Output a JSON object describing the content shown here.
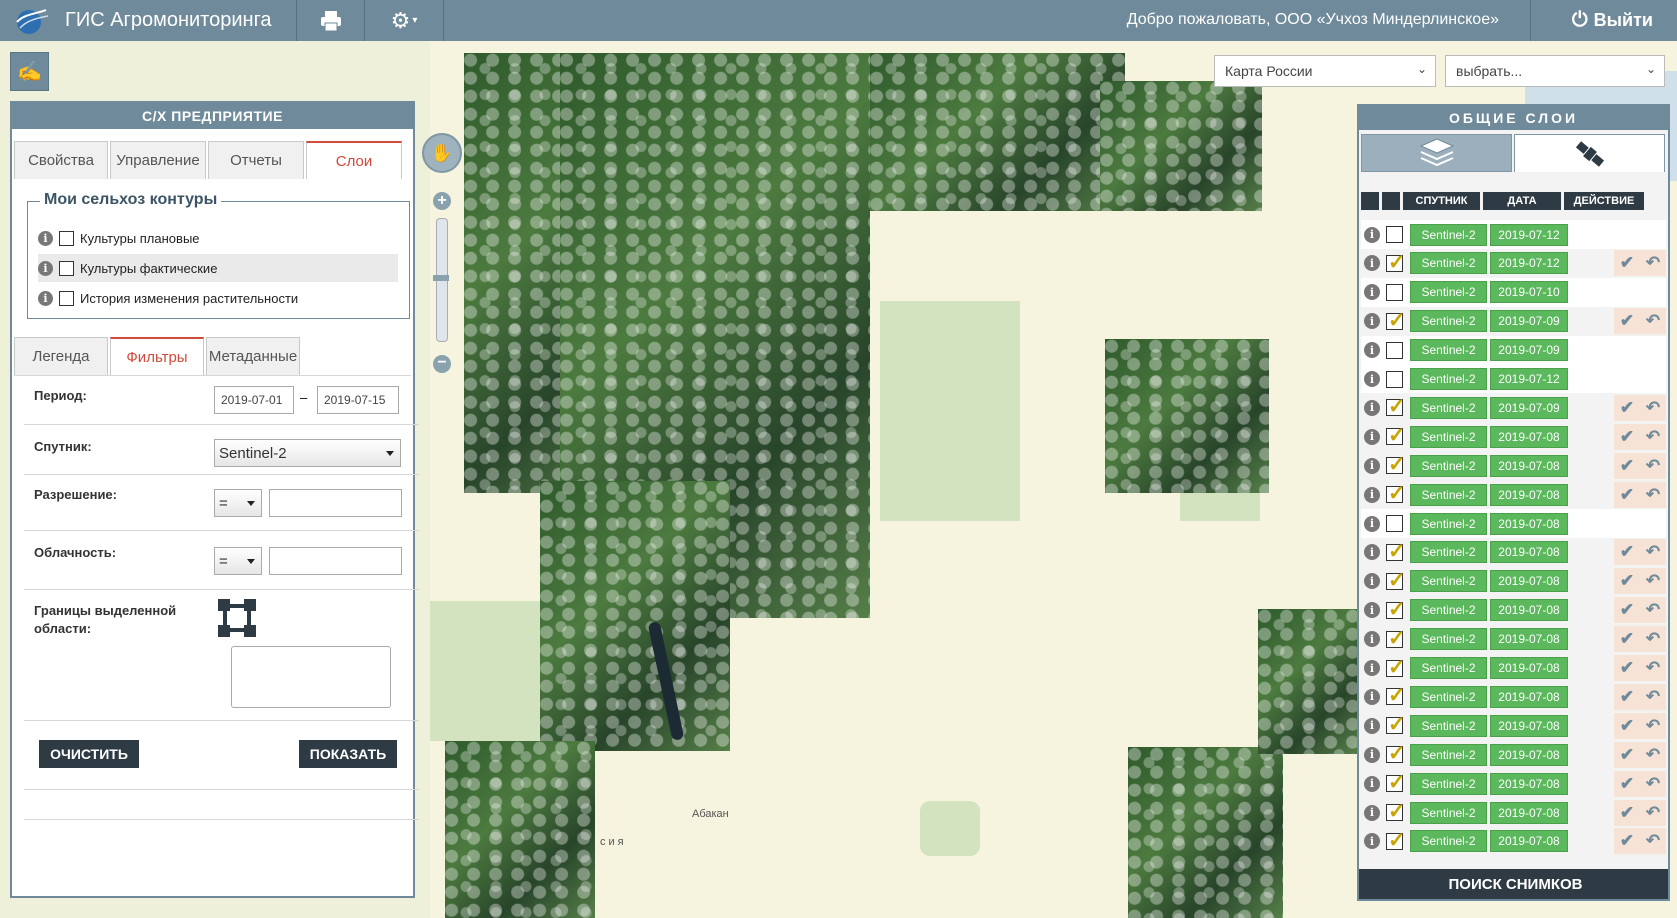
{
  "topbar": {
    "title": "ГИС Агромониторинга",
    "welcome": "Добро пожаловать, ООО «Учхоз Миндерлинское»",
    "logout": "Выйти"
  },
  "map": {
    "base_select": "Карта России",
    "choose_select": "выбрать...",
    "labels": [
      "Абакан",
      "сия"
    ]
  },
  "left_panel": {
    "title": "С/Х ПРЕДПРИЯТИЕ",
    "tabs": [
      "Свойства",
      "Управление",
      "Отчеты",
      "Слои"
    ],
    "active_tab": "Слои",
    "contours": {
      "legend": "Мои сельхоз контуры",
      "items": [
        "Культуры плановые",
        "Культуры фактические",
        "История изменения растительности"
      ]
    },
    "subtabs": [
      "Легенда",
      "Фильтры",
      "Метаданные"
    ],
    "active_subtab": "Фильтры",
    "filters": {
      "period_label": "Период:",
      "date_from": "2019-07-01",
      "date_dash": "–",
      "date_to": "2019-07-15",
      "satellite_label": "Спутник:",
      "satellite_value": "Sentinel-2",
      "resolution_label": "Разрешение:",
      "resolution_op": "=",
      "cloud_label": "Облачность:",
      "cloud_op": "=",
      "bounds_label": "Границы выделенной области:"
    },
    "clear_button": "ОЧИСТИТЬ",
    "show_button": "ПОКАЗАТЬ"
  },
  "right_panel": {
    "title": "ОБЩИЕ СЛОИ",
    "columns": [
      "СПУТНИК",
      "ДАТА",
      "ДЕЙСТВИЕ"
    ],
    "rows": [
      {
        "sat": "Sentinel-2",
        "date": "2019-07-12",
        "checked": false
      },
      {
        "sat": "Sentinel-2",
        "date": "2019-07-12",
        "checked": true
      },
      {
        "sat": "Sentinel-2",
        "date": "2019-07-10",
        "checked": false
      },
      {
        "sat": "Sentinel-2",
        "date": "2019-07-09",
        "checked": true
      },
      {
        "sat": "Sentinel-2",
        "date": "2019-07-09",
        "checked": false
      },
      {
        "sat": "Sentinel-2",
        "date": "2019-07-12",
        "checked": false
      },
      {
        "sat": "Sentinel-2",
        "date": "2019-07-09",
        "checked": true
      },
      {
        "sat": "Sentinel-2",
        "date": "2019-07-08",
        "checked": true
      },
      {
        "sat": "Sentinel-2",
        "date": "2019-07-08",
        "checked": true
      },
      {
        "sat": "Sentinel-2",
        "date": "2019-07-08",
        "checked": true
      },
      {
        "sat": "Sentinel-2",
        "date": "2019-07-08",
        "checked": false
      },
      {
        "sat": "Sentinel-2",
        "date": "2019-07-08",
        "checked": true
      },
      {
        "sat": "Sentinel-2",
        "date": "2019-07-08",
        "checked": true
      },
      {
        "sat": "Sentinel-2",
        "date": "2019-07-08",
        "checked": true
      },
      {
        "sat": "Sentinel-2",
        "date": "2019-07-08",
        "checked": true
      },
      {
        "sat": "Sentinel-2",
        "date": "2019-07-08",
        "checked": true
      },
      {
        "sat": "Sentinel-2",
        "date": "2019-07-08",
        "checked": true
      },
      {
        "sat": "Sentinel-2",
        "date": "2019-07-08",
        "checked": true
      },
      {
        "sat": "Sentinel-2",
        "date": "2019-07-08",
        "checked": true
      },
      {
        "sat": "Sentinel-2",
        "date": "2019-07-08",
        "checked": true
      },
      {
        "sat": "Sentinel-2",
        "date": "2019-07-08",
        "checked": true
      },
      {
        "sat": "Sentinel-2",
        "date": "2019-07-08",
        "checked": true
      }
    ],
    "search_button": "ПОИСК СНИМКОВ"
  },
  "colors": {
    "header": "#6f8a9a",
    "dark": "#2f3b44",
    "accent": "#d14a3a",
    "pill": "#5cb85c"
  },
  "icons": [
    "globe-logo-icon",
    "print-icon",
    "gear-icon",
    "power-icon",
    "draw-icon",
    "pan-icon",
    "zoom-in-icon",
    "zoom-out-icon",
    "layers-icon",
    "satellite-icon",
    "bounds-select-icon",
    "info-icon",
    "apply-icon",
    "undo-icon"
  ]
}
